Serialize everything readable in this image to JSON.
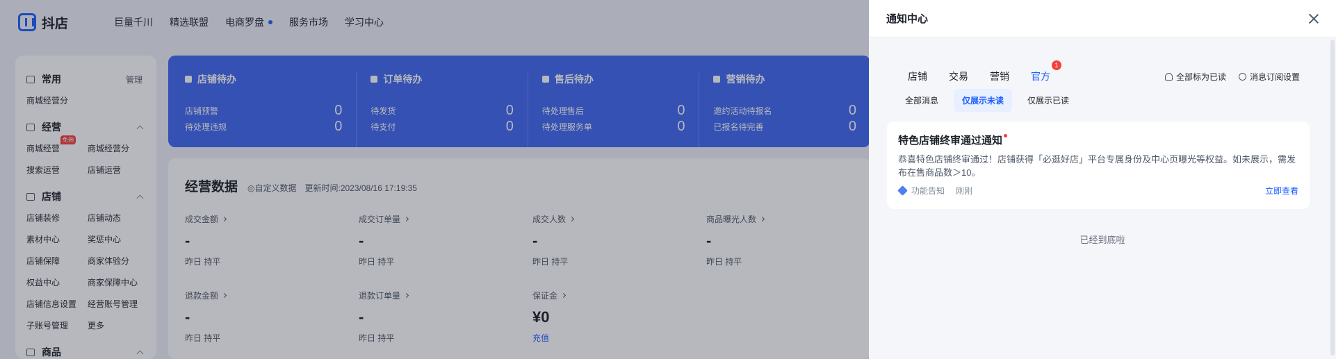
{
  "brand": {
    "name": "抖店"
  },
  "nav": {
    "items": [
      {
        "label": "巨量千川"
      },
      {
        "label": "精选联盟"
      },
      {
        "label": "电商罗盘"
      },
      {
        "label": "服务市场"
      },
      {
        "label": "学习中心"
      }
    ]
  },
  "sidebar": {
    "common": {
      "title": "常用",
      "manage": "管理",
      "items": [
        "商城经营分"
      ]
    },
    "ops": {
      "title": "经营",
      "items": [
        "商城经营",
        "商城经营分",
        "搜索运营",
        "店铺运营"
      ],
      "badge": "免佣"
    },
    "shop": {
      "title": "店铺",
      "items": [
        "店铺装修",
        "店铺动态",
        "素材中心",
        "奖惩中心",
        "店铺保障",
        "商家体验分",
        "权益中心",
        "商家保障中心",
        "店铺信息设置",
        "经营账号管理",
        "子账号管理",
        "更多"
      ]
    },
    "goods": {
      "title": "商品"
    }
  },
  "todo": {
    "columns": [
      {
        "title": "店铺待办",
        "rows": [
          {
            "label": "店铺预警",
            "value": "0"
          },
          {
            "label": "待处理违规",
            "value": "0"
          }
        ]
      },
      {
        "title": "订单待办",
        "rows": [
          {
            "label": "待发货",
            "value": "0"
          },
          {
            "label": "待支付",
            "value": "0"
          }
        ]
      },
      {
        "title": "售后待办",
        "rows": [
          {
            "label": "待处理售后",
            "value": "0"
          },
          {
            "label": "待处理服务单",
            "value": "0"
          }
        ]
      },
      {
        "title": "营销待办",
        "rows": [
          {
            "label": "邀约活动待报名",
            "value": "0"
          },
          {
            "label": "已报名待完善",
            "value": "0"
          }
        ]
      }
    ]
  },
  "business": {
    "title": "经营数据",
    "custom": "◎自定义数据",
    "updated": "更新时间:2023/08/16 17:19:35",
    "metrics": [
      {
        "label": "成交金额",
        "value": "-",
        "sub": "昨日 持平"
      },
      {
        "label": "成交订单量",
        "value": "-",
        "sub": "昨日 持平"
      },
      {
        "label": "成交人数",
        "value": "-",
        "sub": "昨日 持平"
      },
      {
        "label": "商品曝光人数",
        "value": "-",
        "sub": "昨日 持平"
      },
      {
        "label": "退款金额",
        "value": "-",
        "sub": "昨日 持平"
      },
      {
        "label": "退款订单量",
        "value": "-",
        "sub": "昨日 持平"
      },
      {
        "label": "保证金",
        "value": "¥0",
        "link": "充值"
      }
    ]
  },
  "drawer": {
    "title": "通知中心",
    "tabs": [
      {
        "label": "店铺"
      },
      {
        "label": "交易"
      },
      {
        "label": "营销"
      },
      {
        "label": "官方",
        "badge": "1"
      }
    ],
    "actions": {
      "mark_all": "全部标为已读",
      "subscribe": "消息订阅设置"
    },
    "filters": [
      "全部消息",
      "仅展示未读",
      "仅展示已读"
    ],
    "notice": {
      "title": "特色店铺终审通过通知",
      "body": "恭喜特色店铺终审通过！店铺获得「必逛好店」平台专属身份及中心页曝光等权益。如未展示，需发布在售商品数＞10。",
      "category": "功能告知",
      "time": "刚刚",
      "link": "立即查看"
    },
    "end_text": "已经到底啦"
  },
  "colors": {
    "accent": "#1c5fff",
    "banner": "#3e68f0",
    "badge": "#f5403c"
  }
}
